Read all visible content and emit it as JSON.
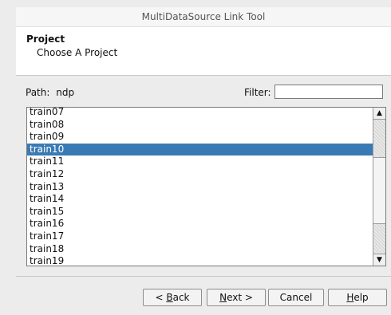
{
  "window": {
    "title": "MultiDataSource Link Tool"
  },
  "header": {
    "title": "Project",
    "subtitle": "Choose A Project"
  },
  "path": {
    "label": "Path:",
    "value": "ndp"
  },
  "filter": {
    "label": "Filter:",
    "value": "",
    "placeholder": ""
  },
  "list": {
    "items": [
      "train07",
      "train08",
      "train09",
      "train10",
      "train11",
      "train12",
      "train13",
      "train14",
      "train15",
      "train16",
      "train17",
      "train18",
      "train19"
    ],
    "selected": "train10"
  },
  "scrollbar": {
    "up_glyph": "▲",
    "down_glyph": "▼"
  },
  "buttons": {
    "back": {
      "prefix": "< ",
      "mnemonic": "B",
      "rest": "ack"
    },
    "next": {
      "mnemonic": "N",
      "rest": "ext >"
    },
    "cancel": {
      "label": "Cancel"
    },
    "help": {
      "mnemonic": "H",
      "rest": "elp"
    }
  }
}
